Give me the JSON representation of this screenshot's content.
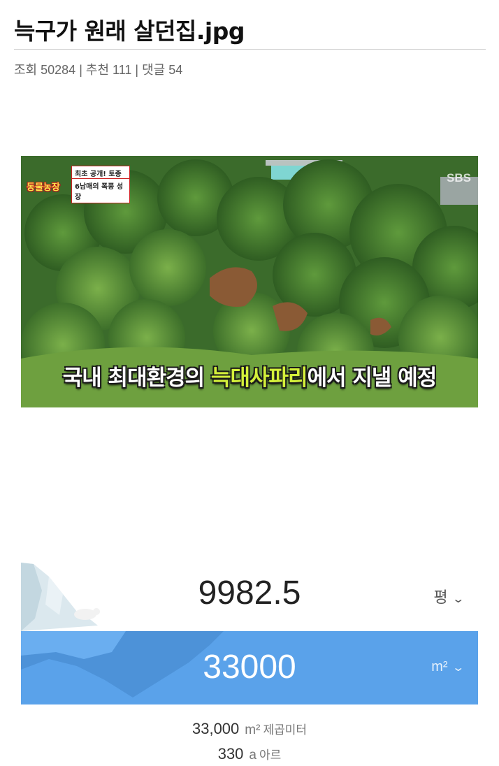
{
  "post": {
    "title": "늑구가 원래 살던집.jpg",
    "views_label": "조회 50284",
    "recommend_label": "추천 111",
    "comments_label": "댓글 54",
    "separator": "|"
  },
  "video_frame": {
    "show_logo": "동물농장",
    "tag_top": "최초 공개! 토종 늑대",
    "tag_bottom": "6남매의 폭풍 성장",
    "broadcaster": "SBS",
    "caption_white": "국내 최대환경의 ",
    "caption_green": "늑대사파리",
    "caption_white2": "에서 지낼 예정"
  },
  "converter": {
    "top_value": "9982.5",
    "top_unit": "평",
    "bottom_value": "33000",
    "bottom_unit": "m²",
    "chevron": "⌄"
  },
  "results": [
    {
      "num": "33,000",
      "unit": "m²",
      "name": "제곱미터"
    },
    {
      "num": "330",
      "unit": "a",
      "name": "아르"
    }
  ],
  "colors": {
    "blue_panel": "#5aa2ea",
    "caption_green": "#d4f03a"
  }
}
